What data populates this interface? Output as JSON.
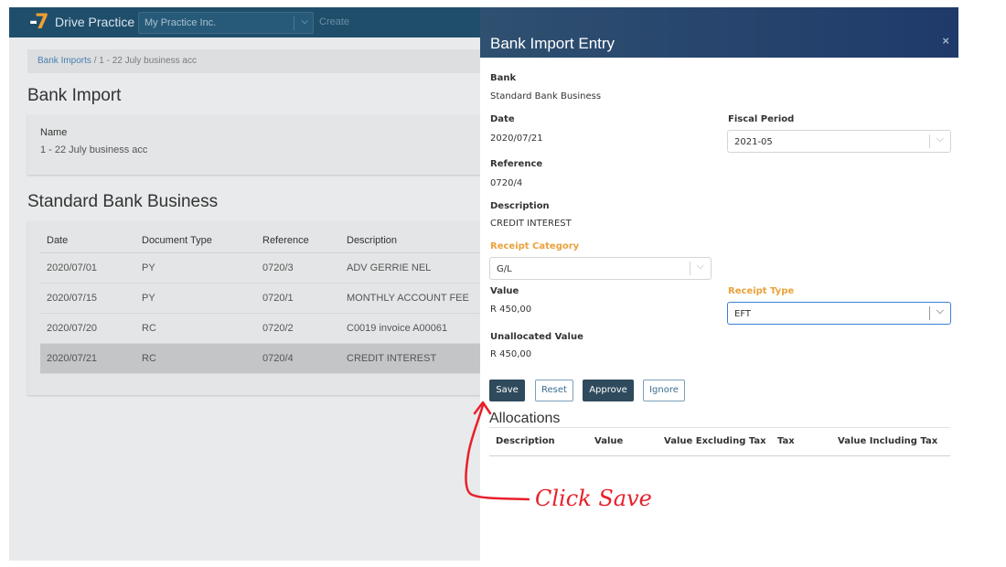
{
  "app": {
    "brand": "Drive Practice",
    "company": "My Practice Inc.",
    "create_label": "Create",
    "breadcrumb": {
      "parent": "Bank Imports",
      "separator": " / ",
      "current": "1 - 22 July business acc"
    },
    "page_title": "Bank Import",
    "name_panel": {
      "label": "Name",
      "value": "1 - 22 July business acc"
    },
    "bank_title": "Standard Bank Business",
    "table": {
      "headers": [
        "Date",
        "Document Type",
        "Reference",
        "Description"
      ],
      "rows": [
        {
          "date": "2020/07/01",
          "doc_type": "PY",
          "reference": "0720/3",
          "description": "ADV GERRIE NEL"
        },
        {
          "date": "2020/07/15",
          "doc_type": "PY",
          "reference": "0720/1",
          "description": "MONTHLY ACCOUNT FEE"
        },
        {
          "date": "2020/07/20",
          "doc_type": "RC",
          "reference": "0720/2",
          "description": "C0019 invoice A00061"
        },
        {
          "date": "2020/07/21",
          "doc_type": "RC",
          "reference": "0720/4",
          "description": "CREDIT INTEREST"
        }
      ]
    }
  },
  "modal": {
    "title": "Bank Import Entry",
    "close_icon": "×",
    "bank": {
      "label": "Bank",
      "value": "Standard Bank Business"
    },
    "date": {
      "label": "Date",
      "value": "2020/07/21"
    },
    "fiscal_period": {
      "label": "Fiscal Period",
      "value": "2021-05"
    },
    "reference": {
      "label": "Reference",
      "value": "0720/4"
    },
    "description": {
      "label": "Description",
      "value": "CREDIT INTEREST"
    },
    "receipt_category": {
      "label": "Receipt Category",
      "value": "G/L"
    },
    "value": {
      "label": "Value",
      "value": "R 450,00"
    },
    "receipt_type": {
      "label": "Receipt Type",
      "value": "EFT"
    },
    "unallocated": {
      "label": "Unallocated Value",
      "value": "R 450,00"
    },
    "buttons": {
      "save": "Save",
      "reset": "Reset",
      "approve": "Approve",
      "ignore": "Ignore"
    },
    "allocations": {
      "title": "Allocations",
      "headers": [
        "Description",
        "Value",
        "Value Excluding Tax",
        "Tax",
        "Value Including Tax"
      ]
    }
  },
  "annotation": {
    "text": "Click Save",
    "color": "#e8202a"
  },
  "colors": {
    "header_dark": "#1f4e6b",
    "required_label": "#e9a23b",
    "button_dark": "#2e4a5c"
  }
}
